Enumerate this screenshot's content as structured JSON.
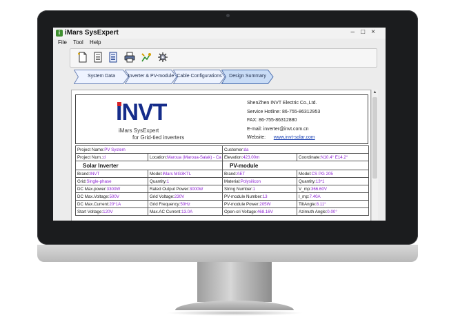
{
  "window": {
    "title": "iMars SysExpert",
    "icon": "app-logo-icon"
  },
  "menu": [
    "File",
    "Tool",
    "Help"
  ],
  "toolbar": [
    "new-file-icon",
    "document-icon",
    "report-icon",
    "print-icon",
    "chart-icon",
    "settings-gear-icon"
  ],
  "steps": [
    "System Data",
    "Inverter & PV-module",
    "Cable Configurations",
    "Design Summary"
  ],
  "active_step": 3,
  "doc": {
    "logo": "INVT",
    "app_name": "iMars SysExpert",
    "app_sub": "for Grid-tied inverters",
    "company": "ShenZhen INVT Electric Co.,Ltd.",
    "hotline": "Service Hotline: 86-755-86312953",
    "fax": "FAX: 86-755-86312880",
    "email": "E-mail: inverter@invt.com.cn",
    "website_label": "Website:",
    "website": "www.invt-solar.com"
  },
  "project": {
    "name_label": "Project Name:",
    "name": "PV System",
    "customer_label": "Customer:",
    "customer": "da",
    "num_label": "Project Num.:",
    "num": "d",
    "location_label": "Location:",
    "location": "Maroua (Maroua-Salak) - Ca",
    "elevation_label": "Elevation:",
    "elevation": "423.00m",
    "coord_label": "Coordinate:",
    "coord": "N10.4° E14.2°"
  },
  "sections": {
    "inverter": "Solar Inverter",
    "pv": "PV-module"
  },
  "rows": [
    [
      [
        "Brand:",
        "INVT"
      ],
      [
        "Model:",
        "iMars MG3KTL"
      ],
      [
        "Brand:",
        "AET"
      ],
      [
        "Model:",
        "CS PG 205"
      ]
    ],
    [
      [
        "Grid:",
        "Single-phase"
      ],
      [
        "Quantity:",
        "1"
      ],
      [
        "Material:",
        "Polysilicon"
      ],
      [
        "Quantity:",
        "13*1"
      ]
    ],
    [
      [
        "DC Max.power:",
        "3300W"
      ],
      [
        "Rated Output Power:",
        "3000W"
      ],
      [
        "String Number:",
        "1"
      ],
      [
        "V_mp:",
        "366.60V"
      ]
    ],
    [
      [
        "DC Max.Voltage:",
        "500V"
      ],
      [
        "Grid Voltage:",
        "230V"
      ],
      [
        "PV-module Number:",
        "13"
      ],
      [
        "I_mp:",
        "7.40A"
      ]
    ],
    [
      [
        "DC Max.Current:",
        "20*1A"
      ],
      [
        "Grid Frequency:",
        "50Hz"
      ],
      [
        "PV-module Power:",
        "205W"
      ],
      [
        "TiltAngle:",
        "8.11°"
      ]
    ],
    [
      [
        "Start Voltage:",
        "120V"
      ],
      [
        "Max.AC Current:",
        "13.0A"
      ],
      [
        "Open-cri Voltage:",
        "468.16V"
      ],
      [
        "Azimuth Angle:",
        "0.00°"
      ]
    ]
  ]
}
